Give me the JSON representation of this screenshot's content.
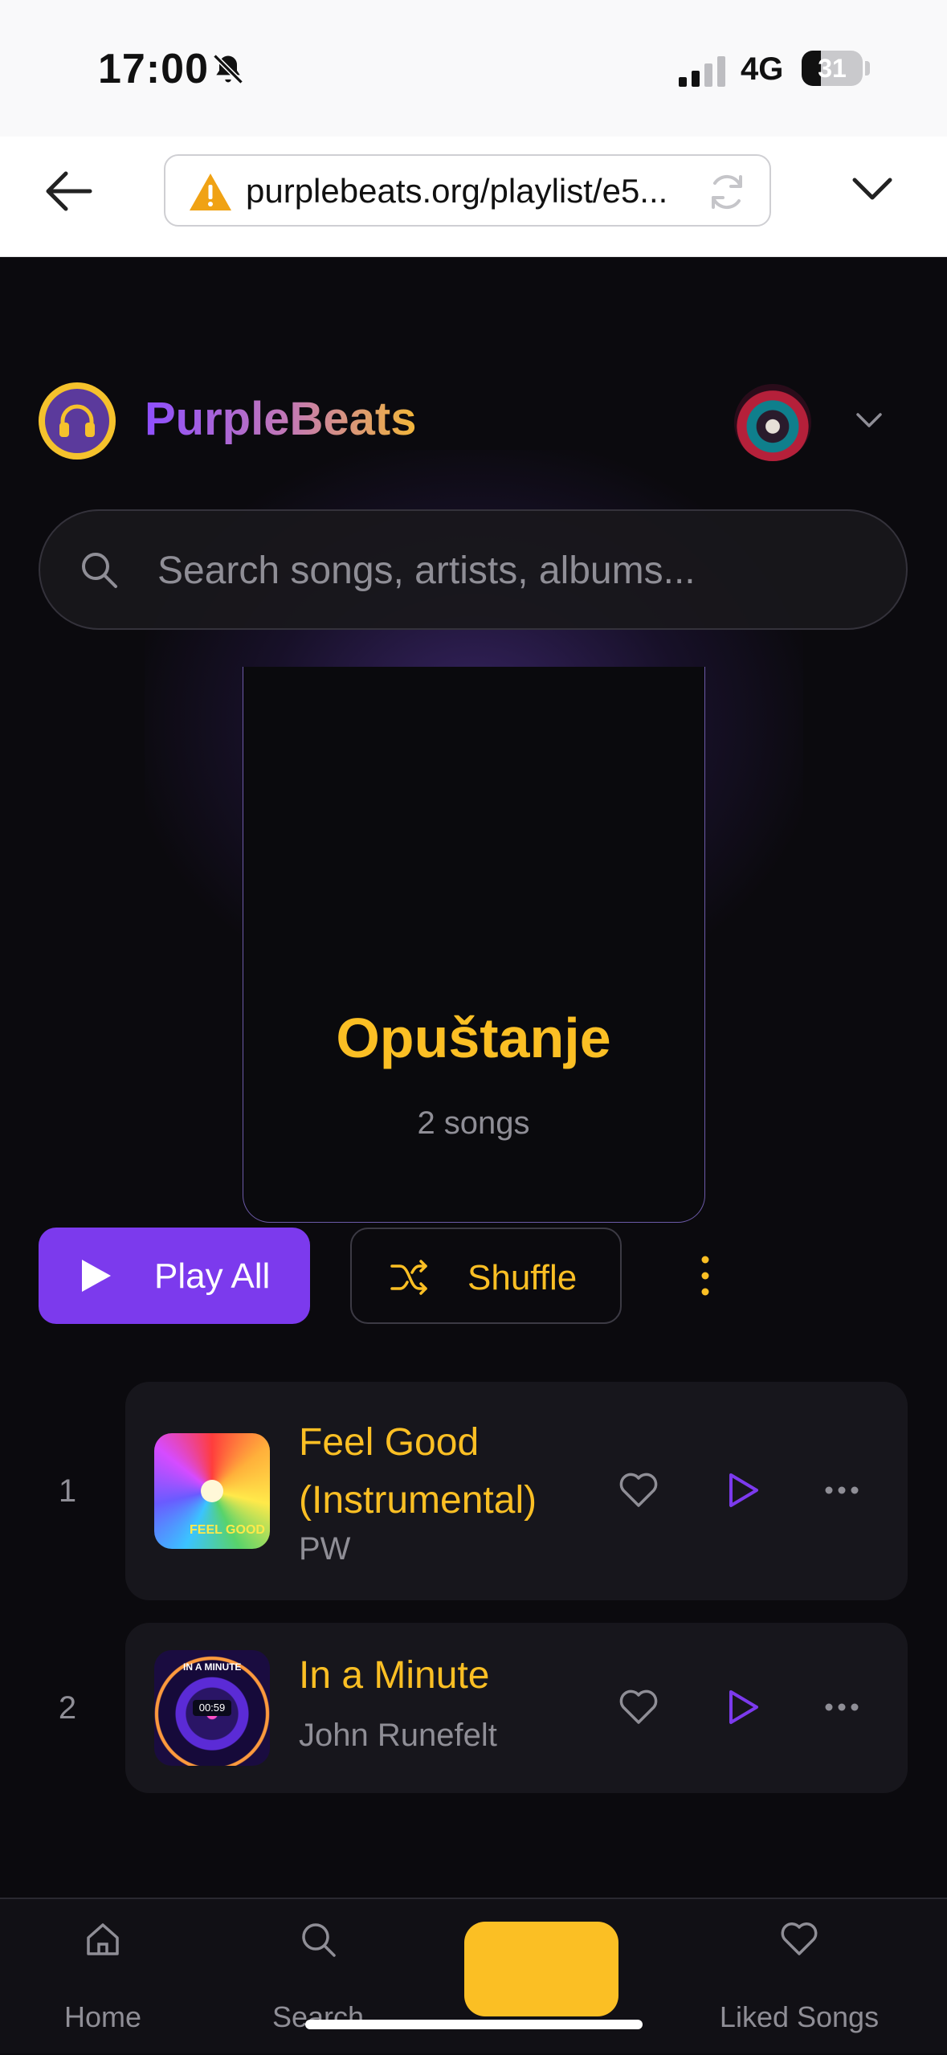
{
  "status_bar": {
    "time": "17:00",
    "network": "4G",
    "battery": "31",
    "battery_level": 0.31,
    "icons": [
      "bell-slash-icon",
      "signal-icon",
      "battery-icon"
    ]
  },
  "browser": {
    "url": "purplebeats.org/playlist/e5...",
    "icons": [
      "back-arrow-icon",
      "warning-icon",
      "reload-icon",
      "chevron-down-icon"
    ]
  },
  "header": {
    "brand": "PurpleBeats",
    "logo_icon": "headphones-icon"
  },
  "search": {
    "placeholder": "Search songs, artists, albums..."
  },
  "playlist": {
    "title": "Opuštanje",
    "song_count": "2 songs"
  },
  "actions": {
    "play_all": "Play All",
    "shuffle": "Shuffle"
  },
  "songs": [
    {
      "index": "1",
      "title": "Feel Good (Instrumental)",
      "artist": "PW",
      "art_text": "FEEL GOOD"
    },
    {
      "index": "2",
      "title": "In a Minute",
      "artist": "John Runefelt",
      "art_text": "IN A MINUTE",
      "art_clock": "00:59"
    }
  ],
  "nav": {
    "items": [
      {
        "label": "Home",
        "icon": "home-icon"
      },
      {
        "label": "Search",
        "icon": "search-icon"
      },
      {
        "label": "Liked Songs",
        "icon": "heart-icon"
      }
    ]
  },
  "colors": {
    "accent_purple": "#7c3aed",
    "accent_gold": "#fbbf24",
    "background": "#0b0a0e"
  }
}
